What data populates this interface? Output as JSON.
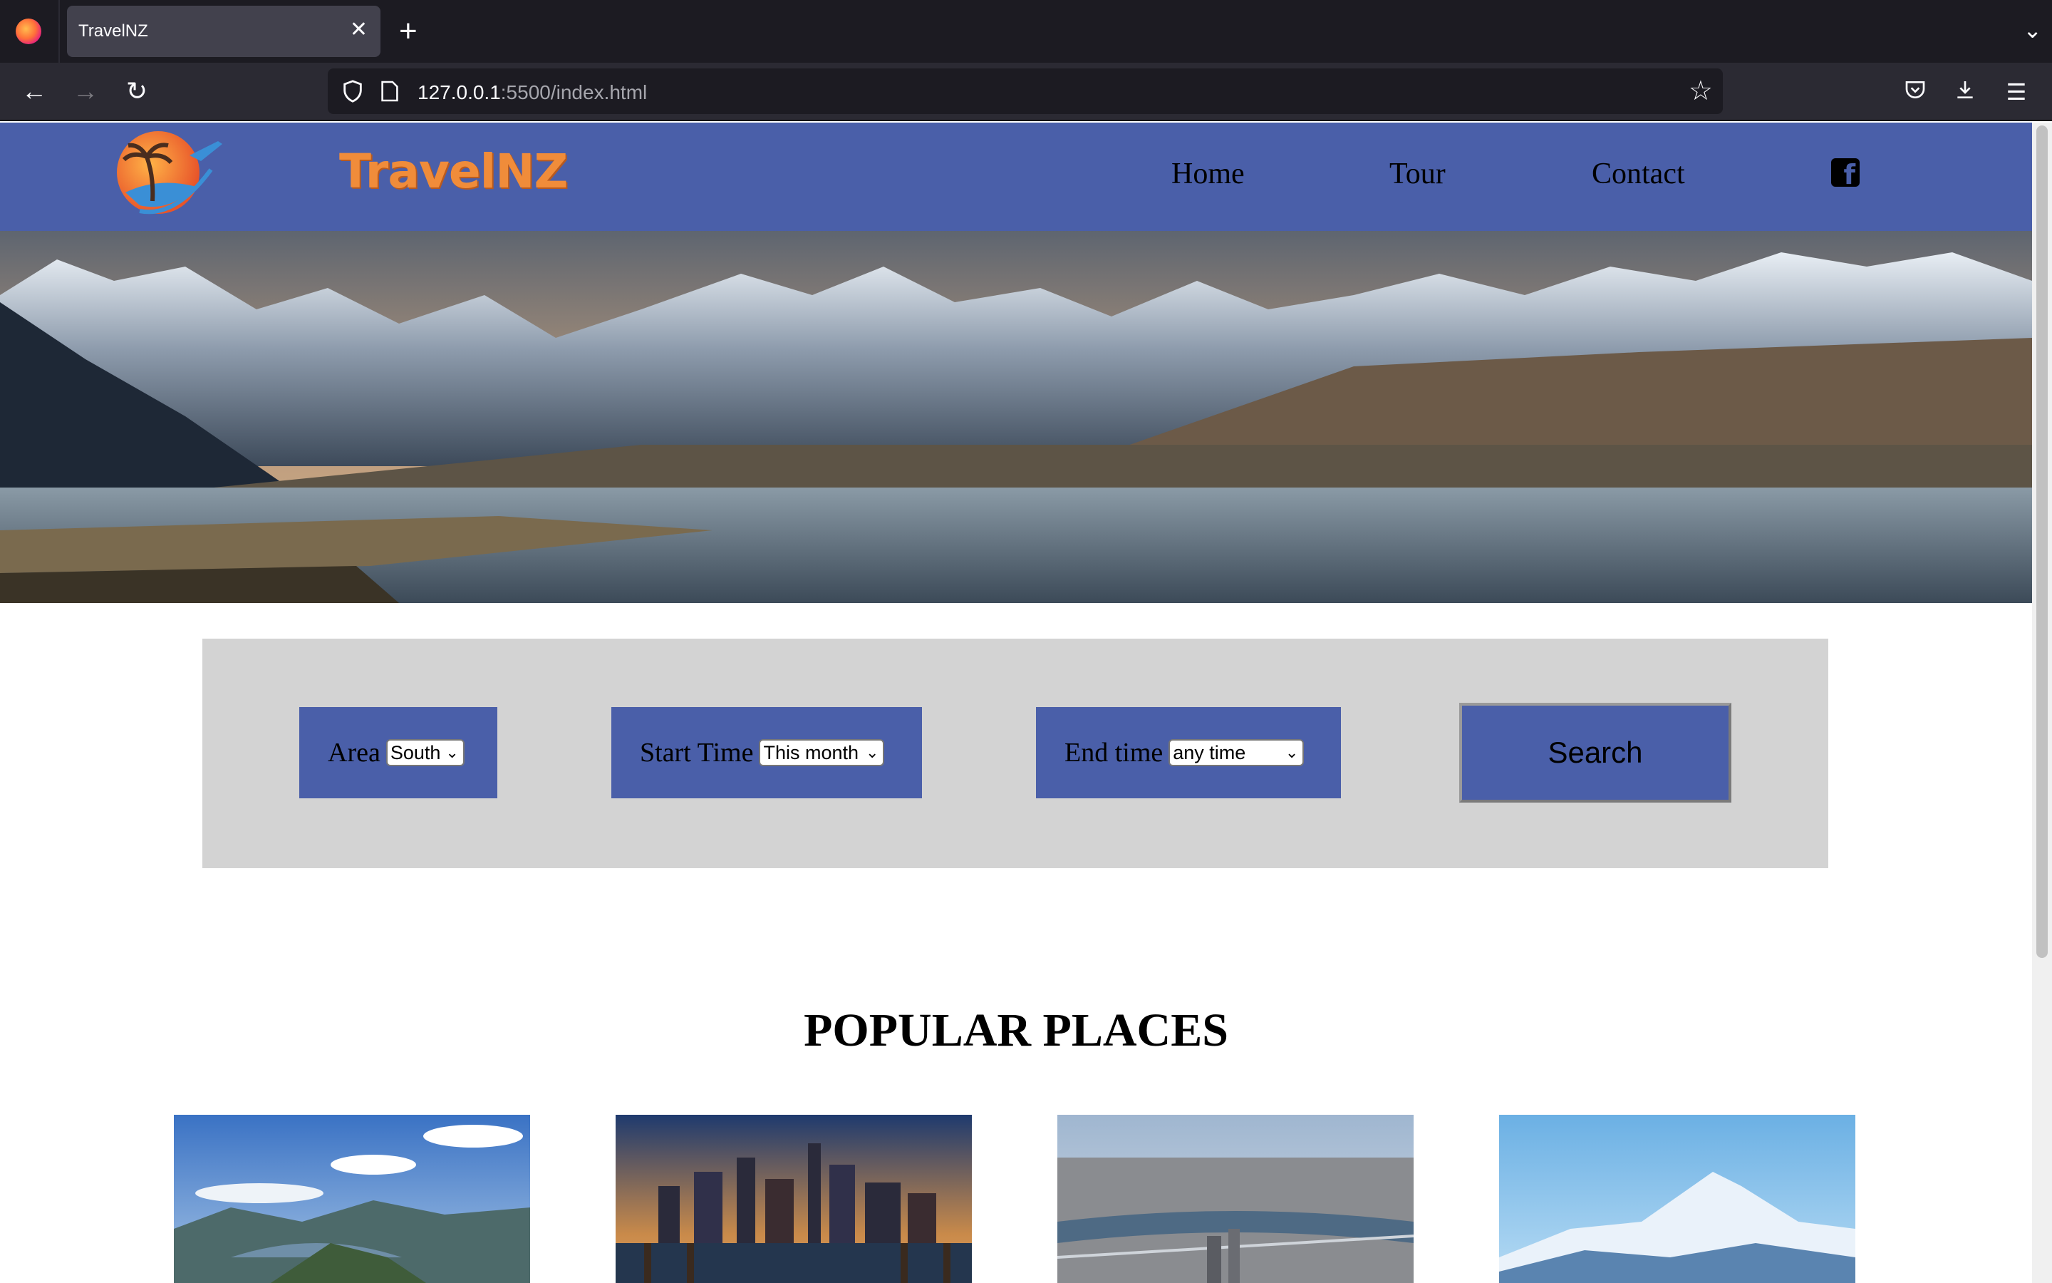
{
  "browser": {
    "tab_title": "TravelNZ",
    "url_host": "127.0.0.1",
    "url_path": ":5500/index.html"
  },
  "site": {
    "logo_text": "TravelNZ",
    "menu": [
      {
        "label": "Home"
      },
      {
        "label": "Tour"
      },
      {
        "label": "Contact"
      }
    ],
    "social_icon": "facebook-icon",
    "brand_color": "#4a5fa9",
    "logo_color": "#f08c3a"
  },
  "search": {
    "area_label": "Area",
    "area_value": "South",
    "start_label": "Start Time",
    "start_value": "This month",
    "end_label": "End time",
    "end_value": "any time",
    "button_label": "Search",
    "panel_color": "#d3d3d3"
  },
  "popular": {
    "title": "POPULAR PLACES",
    "places": [
      {
        "image": "lake-wanaka-ridge"
      },
      {
        "image": "city-skyline-at-dusk"
      },
      {
        "image": "aerial-city-bridge"
      },
      {
        "image": "mount-cook-peak"
      }
    ]
  }
}
